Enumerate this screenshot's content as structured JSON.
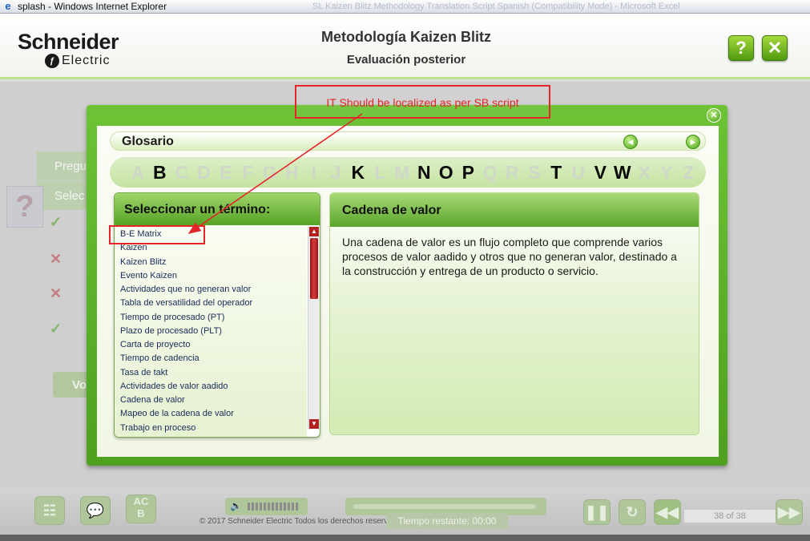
{
  "window": {
    "title": "splash - Windows Internet Explorer",
    "background_title": "SL Kaizen Blitz Methodology Translation Script Spanish (Compatibility Mode) - Microsoft Excel"
  },
  "header": {
    "logo_top": "Schneider",
    "logo_bottom": "Electric",
    "course_title": "Metodología Kaizen Blitz",
    "course_subtitle": "Evaluación posterior",
    "help_label": "?",
    "close_label": "✕"
  },
  "background": {
    "tab1": "Pregu",
    "tab2": "Selec",
    "question_mark": "?",
    "marks": [
      "✓",
      "✕",
      "✕",
      "✓"
    ],
    "button": "Vo"
  },
  "glossary": {
    "title": "Glosario",
    "close_label": "✕",
    "prev_label": "◀",
    "next_label": "▶",
    "letters": [
      {
        "char": "A",
        "active": false
      },
      {
        "char": "B",
        "active": true
      },
      {
        "char": "C",
        "active": false
      },
      {
        "char": "D",
        "active": false
      },
      {
        "char": "E",
        "active": false
      },
      {
        "char": "F",
        "active": false
      },
      {
        "char": "G",
        "active": false
      },
      {
        "char": "H",
        "active": false
      },
      {
        "char": "I",
        "active": false
      },
      {
        "char": "J",
        "active": false
      },
      {
        "char": "K",
        "active": true
      },
      {
        "char": "L",
        "active": false
      },
      {
        "char": "M",
        "active": false
      },
      {
        "char": "N",
        "active": true
      },
      {
        "char": "O",
        "active": true
      },
      {
        "char": "P",
        "active": true
      },
      {
        "char": "Q",
        "active": false
      },
      {
        "char": "R",
        "active": false
      },
      {
        "char": "S",
        "active": false
      },
      {
        "char": "T",
        "active": true
      },
      {
        "char": "U",
        "active": false
      },
      {
        "char": "V",
        "active": true
      },
      {
        "char": "W",
        "active": true
      },
      {
        "char": "X",
        "active": false
      },
      {
        "char": "Y",
        "active": false
      },
      {
        "char": "Z",
        "active": false
      }
    ],
    "list_header": "Seleccionar un término:",
    "terms": [
      "B-E Matrix",
      "Kaizen",
      "Kaizen Blitz",
      "Evento Kaizen",
      "Actividades que no generan valor",
      "Tabla de versatilidad del operador",
      "Tiempo de procesado (PT)",
      "Plazo de procesado (PLT)",
      "Carta de proyecto",
      "Tiempo de cadencia",
      "Tasa de takt",
      "Actividades de valor aadido",
      "Cadena de valor",
      "Mapeo de la cadena de valor",
      "Trabajo en proceso"
    ],
    "selected_index": 12,
    "definition_title": "Cadena de valor",
    "definition_text": "Una cadena de valor es un flujo completo que comprende varios procesos de valor aadido y otros que no generan valor, destinado a la construcción y entrega de un producto o servicio."
  },
  "annotation": {
    "text": "IT Should be localized as per SB script",
    "color": "#e5252a"
  },
  "bottom_bar": {
    "copyright": "© 2017 Schneider Electric Todos los derechos reservados.",
    "remaining_label": "Tiempo restante:",
    "remaining_value": "00:00",
    "page": "38 of 38",
    "icons": [
      "sitemap-icon",
      "chat-icon",
      "glossary-icon",
      "pause-icon",
      "replay-icon",
      "rewind-icon",
      "forward-icon"
    ]
  },
  "colors": {
    "accent_green": "#5aa62b",
    "annotation_red": "#e5252a"
  }
}
